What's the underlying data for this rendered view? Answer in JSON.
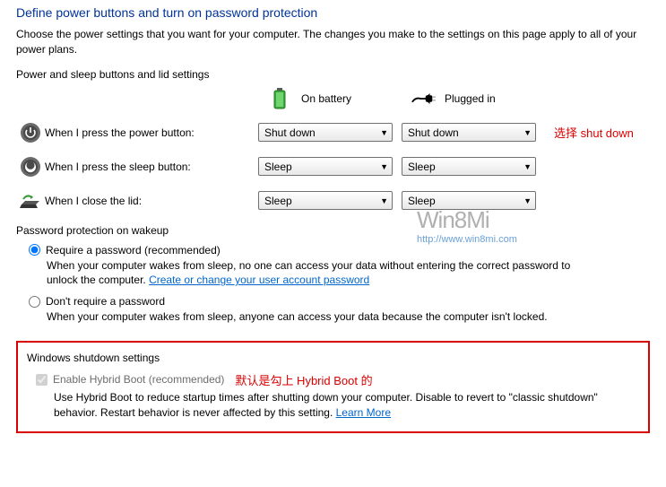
{
  "header": {
    "title": "Define power buttons and turn on password protection",
    "description": "Choose the power settings that you want for your computer. The changes you make to the settings on this page apply to all of your power plans."
  },
  "powerSleep": {
    "sectionLabel": "Power and sleep buttons and lid settings",
    "columns": {
      "battery": "On battery",
      "plugged": "Plugged in"
    },
    "rows": {
      "power": {
        "label": "When I press the power button:",
        "battery": "Shut down",
        "plugged": "Shut down"
      },
      "sleep": {
        "label": "When I press the sleep button:",
        "battery": "Sleep",
        "plugged": "Sleep"
      },
      "lid": {
        "label": "When I close the lid:",
        "battery": "Sleep",
        "plugged": "Sleep"
      }
    },
    "annotation": "选择 shut down"
  },
  "password": {
    "sectionLabel": "Password protection on wakeup",
    "require": {
      "label": "Require a password (recommended)",
      "desc": "When your computer wakes from sleep, no one can access your data without entering the correct password to unlock the computer. ",
      "link": "Create or change your user account password"
    },
    "dont": {
      "label": "Don't require a password",
      "desc": "When your computer wakes from sleep, anyone can access your data because the computer isn't locked."
    }
  },
  "shutdown": {
    "sectionLabel": "Windows shutdown settings",
    "hybrid": {
      "label": "Enable Hybrid Boot (recommended)",
      "annotation": "默认是勾上 Hybrid Boot 的",
      "desc": "Use Hybrid Boot to reduce startup times after shutting down your computer. Disable to revert to \"classic shutdown\" behavior. Restart behavior is never affected by this setting. ",
      "link": "Learn More"
    }
  },
  "watermark": {
    "brand": "Win8Mi",
    "url": "http://www.win8mi.com"
  }
}
